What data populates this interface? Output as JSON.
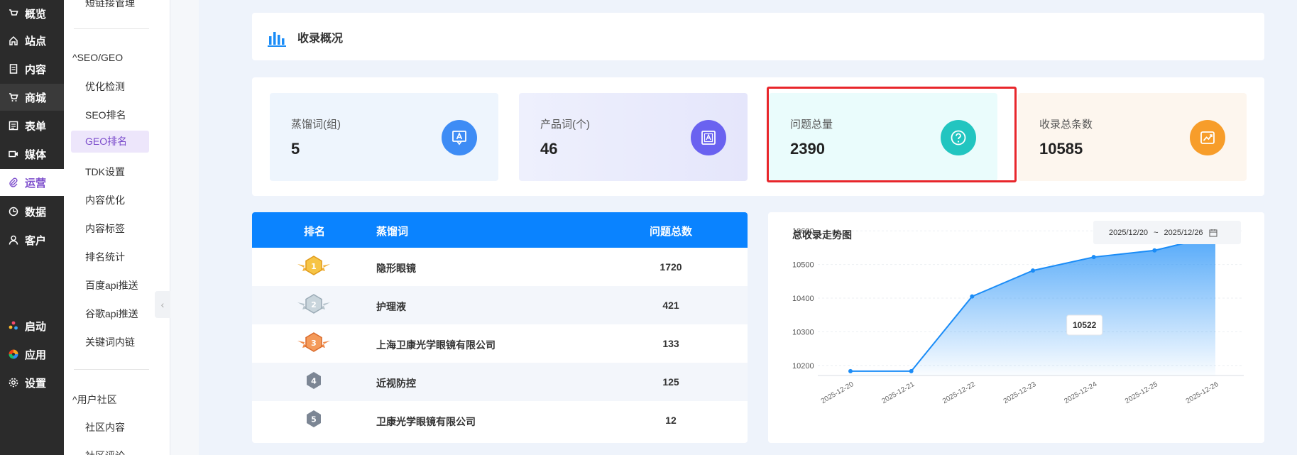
{
  "nav": {
    "items": [
      {
        "label": "概览",
        "icon": "overview-icon"
      },
      {
        "label": "站点",
        "icon": "home-icon"
      },
      {
        "label": "内容",
        "icon": "document-icon"
      },
      {
        "label": "商城",
        "icon": "cart-icon"
      },
      {
        "label": "表单",
        "icon": "form-icon"
      },
      {
        "label": "媒体",
        "icon": "video-icon"
      },
      {
        "label": "运营",
        "icon": "paperclip-icon"
      },
      {
        "label": "数据",
        "icon": "pie-icon"
      },
      {
        "label": "客户",
        "icon": "user-icon"
      }
    ],
    "bottom": [
      {
        "label": "启动",
        "icon": "launch-icon"
      },
      {
        "label": "应用",
        "icon": "apps-icon"
      },
      {
        "label": "设置",
        "icon": "gear-icon"
      }
    ]
  },
  "subnav": {
    "top_partial": "短链接管理",
    "section1": "SEO/GEO",
    "items": [
      "优化检测",
      "SEO排名",
      "GEO排名",
      "TDK设置",
      "内容优化",
      "内容标签",
      "排名统计",
      "百度api推送",
      "谷歌api推送",
      "关键词内链"
    ],
    "section2": "用户社区",
    "items2": [
      "社区内容",
      "社区评论"
    ]
  },
  "header": {
    "title": "收录概况"
  },
  "stats": [
    {
      "label": "蒸馏词(组)",
      "value": "5",
      "icon": "text-box-icon",
      "color": "#3e8cf5"
    },
    {
      "label": "产品词(个)",
      "value": "46",
      "icon": "text-frame-icon",
      "color": "#6a62f0"
    },
    {
      "label": "问题总量",
      "value": "2390",
      "icon": "question-icon",
      "color": "#22c5c0"
    },
    {
      "label": "收录总条数",
      "value": "10585",
      "icon": "trend-icon",
      "color": "#f79d2a"
    }
  ],
  "table": {
    "headers": [
      "排名",
      "蒸馏词",
      "问题总数"
    ],
    "rows": [
      {
        "rank": "1",
        "name": "隐形眼镜",
        "count": "1720"
      },
      {
        "rank": "2",
        "name": "护理液",
        "count": "421"
      },
      {
        "rank": "3",
        "name": "上海卫康光学眼镜有限公司",
        "count": "133"
      },
      {
        "rank": "4",
        "name": "近视防控",
        "count": "125"
      },
      {
        "rank": "5",
        "name": "卫康光学眼镜有限公司",
        "count": "12"
      }
    ]
  },
  "chart": {
    "date_start": "2025/12/20",
    "date_sep": "~",
    "date_end": "2025/12/26"
  },
  "chart_data": {
    "type": "area",
    "title": "总收录走势图",
    "x": [
      "2025-12-20",
      "2025-12-21",
      "2025-12-22",
      "2025-12-23",
      "2025-12-24",
      "2025-12-25",
      "2025-12-26"
    ],
    "values": [
      10183,
      10183,
      10405,
      10482,
      10522,
      10542,
      10585
    ],
    "yticks": [
      10200,
      10300,
      10400,
      10500,
      10600
    ],
    "ylim": [
      10170,
      10630
    ],
    "tooltip": "10522",
    "tooltip_index": 4,
    "colors": {
      "line": "#1a8cf7",
      "fill": "#1a8cf7"
    }
  }
}
